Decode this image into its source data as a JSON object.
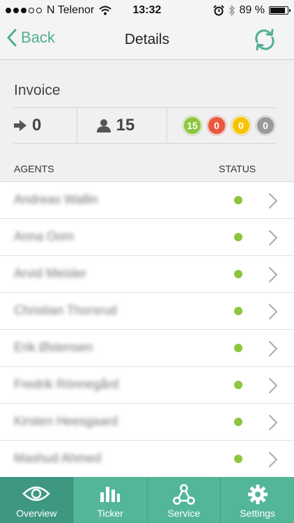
{
  "status_bar": {
    "carrier": "N Telenor",
    "time": "13:32",
    "battery": "89 %",
    "battery_level": 0.89,
    "signal_bars": 3
  },
  "nav": {
    "back_label": "Back",
    "title": "Details",
    "refresh_icon": "refresh-icon"
  },
  "header": {
    "title": "Invoice",
    "forwarded_count": "0",
    "users_count": "15",
    "status_counts": [
      {
        "value": "15",
        "color": "#8cc63f"
      },
      {
        "value": "0",
        "color": "#e9573f"
      },
      {
        "value": "0",
        "color": "#f6c400"
      },
      {
        "value": "0",
        "color": "#9a9a9a"
      }
    ]
  },
  "columns": {
    "agents": "AGENTS",
    "status": "STATUS"
  },
  "agents": [
    {
      "name": "Andreas Wallin",
      "status_color": "#8cc63f"
    },
    {
      "name": "Anna Oom",
      "status_color": "#8cc63f"
    },
    {
      "name": "Arvid Meisler",
      "status_color": "#8cc63f"
    },
    {
      "name": "Christian Thorsrud",
      "status_color": "#8cc63f"
    },
    {
      "name": "Erik Østensen",
      "status_color": "#8cc63f"
    },
    {
      "name": "Fredrik Rönnegård",
      "status_color": "#8cc63f"
    },
    {
      "name": "Kirsten Heesgaard",
      "status_color": "#8cc63f"
    },
    {
      "name": "Mashud Ahmed",
      "status_color": "#8cc63f"
    }
  ],
  "tabs": [
    {
      "label": "Overview",
      "icon": "eye-icon",
      "active": true
    },
    {
      "label": "Ticker",
      "icon": "bar-chart-icon",
      "active": false
    },
    {
      "label": "Service",
      "icon": "network-icon",
      "active": false
    },
    {
      "label": "Settings",
      "icon": "gear-icon",
      "active": false
    }
  ],
  "colors": {
    "accent": "#4fae95",
    "tabbar": "#53b699",
    "tab_active": "#3e9781"
  }
}
